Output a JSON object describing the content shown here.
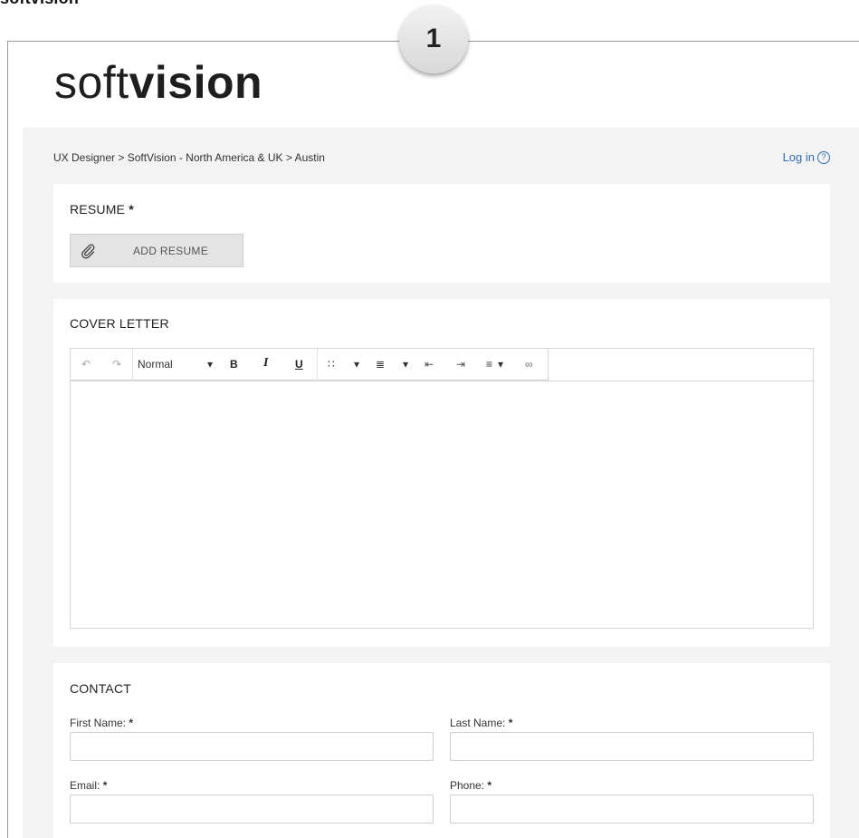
{
  "header": {
    "caption": "softvision",
    "step_number": "1"
  },
  "logo": {
    "text_light": "soft",
    "text_bold": "vision"
  },
  "breadcrumb": "UX Designer > SoftVision - North America & UK > Austin",
  "login": {
    "label": "Log in",
    "icon": "help-circle-icon"
  },
  "resume": {
    "title": "RESUME",
    "required_mark": "*",
    "button_label": "ADD RESUME",
    "button_icon": "paperclip-icon"
  },
  "cover_letter": {
    "title": "COVER LETTER",
    "toolbar": {
      "undo_icon": "↶",
      "redo_icon": "↷",
      "format_value": "Normal",
      "caret": "▾",
      "bold": "B",
      "italic": "I",
      "underline": "U",
      "bullet_icon": "∷",
      "number_icon": "≣",
      "outdent_icon": "⇤",
      "indent_icon": "⇥",
      "align_icon": "≡",
      "link_icon": "∞"
    }
  },
  "contact": {
    "title": "CONTACT",
    "first_name": "First Name:",
    "last_name": "Last Name:",
    "email": "Email:",
    "phone": "Phone:",
    "required_mark": "*"
  }
}
